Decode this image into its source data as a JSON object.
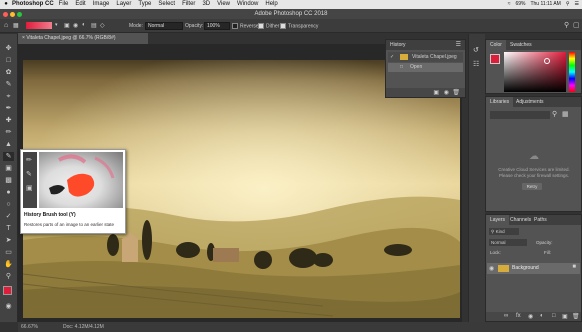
{
  "menubar": {
    "app_name": "Photoshop CC",
    "items": [
      "File",
      "Edit",
      "Image",
      "Layer",
      "Type",
      "Select",
      "Filter",
      "3D",
      "View",
      "Window",
      "Help"
    ],
    "battery": "69%",
    "clock": "Thu 11:11 AM"
  },
  "window": {
    "title": "Adobe Photoshop CC 2018"
  },
  "options": {
    "mode_label": "Mode:",
    "mode_value": "Normal",
    "opacity_label": "Opacity:",
    "opacity_value": "100%",
    "reverse_label": "Reverse",
    "dither_label": "Dither",
    "transparency_label": "Transparency"
  },
  "document": {
    "tab_label": "Vitaleta Chapel.jpeg @ 66.7% (RGB/8#)",
    "zoom": "66.67%",
    "doc_size": "Doc: 4.12M/4.12M"
  },
  "history_panel": {
    "title": "History",
    "snapshot_name": "Vitaleta Chapel.jpeg",
    "states": [
      "Open"
    ]
  },
  "color_panel": {
    "tabs": [
      "Color",
      "Swatches"
    ]
  },
  "libraries_panel": {
    "tabs": [
      "Libraries",
      "Adjustments"
    ],
    "message": "Creative Cloud Services are limited. Please check your firewall settings.",
    "retry_label": "Retry"
  },
  "layers_panel": {
    "tabs": [
      "Layers",
      "Channels",
      "Paths"
    ],
    "kind_label": "Kind",
    "blend_mode": "Normal",
    "opacity_label": "Opacity:",
    "lock_label": "Lock:",
    "fill_label": "Fill:",
    "layers": [
      {
        "name": "Background"
      }
    ]
  },
  "tooltip": {
    "title": "History Brush tool (Y)",
    "description": "Restores parts of an image to an earlier state"
  },
  "colors": {
    "foreground": "#e01c3b",
    "background": "#ffffff",
    "accent": "#e01c3b"
  }
}
